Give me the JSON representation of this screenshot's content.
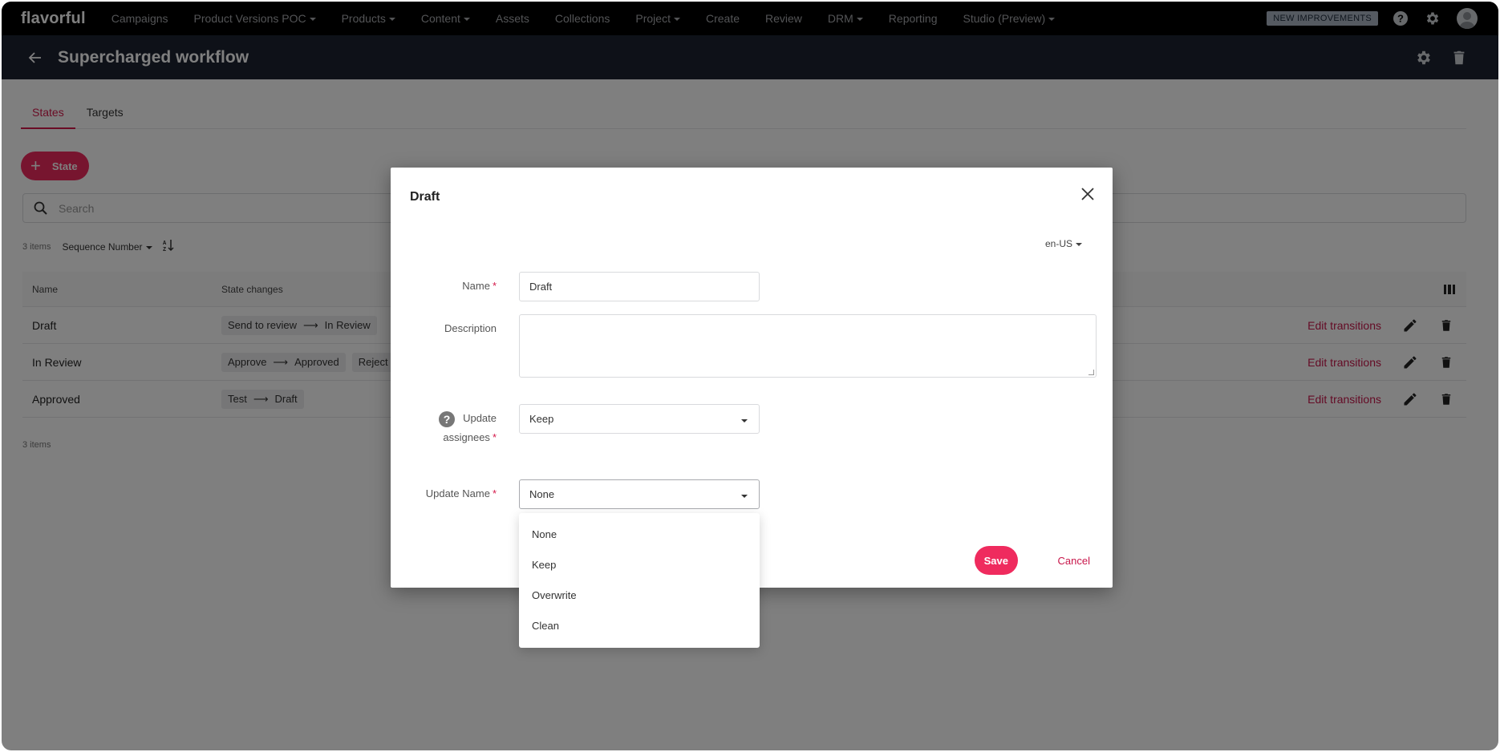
{
  "topnav": {
    "logo": "flavorful",
    "items": [
      {
        "label": "Campaigns",
        "dropdown": false
      },
      {
        "label": "Product Versions POC",
        "dropdown": true
      },
      {
        "label": "Products",
        "dropdown": true
      },
      {
        "label": "Content",
        "dropdown": true
      },
      {
        "label": "Assets",
        "dropdown": false
      },
      {
        "label": "Collections",
        "dropdown": false
      },
      {
        "label": "Project",
        "dropdown": true
      },
      {
        "label": "Create",
        "dropdown": false
      },
      {
        "label": "Review",
        "dropdown": false
      },
      {
        "label": "DRM",
        "dropdown": true
      },
      {
        "label": "Reporting",
        "dropdown": false
      },
      {
        "label": "Studio (Preview)",
        "dropdown": true
      }
    ],
    "badge": "NEW IMPROVEMENTS",
    "icons": [
      "help-icon",
      "settings-icon",
      "user-avatar-icon"
    ]
  },
  "subheader": {
    "title": "Supercharged workflow",
    "icons": [
      "back-arrow-icon",
      "settings-icon",
      "trash-icon"
    ]
  },
  "tabs": [
    {
      "label": "States",
      "active": true
    },
    {
      "label": "Targets",
      "active": false
    }
  ],
  "add_state_label": "State",
  "search": {
    "placeholder": "Search",
    "value": ""
  },
  "list": {
    "count_label": "3 items",
    "sort_by": "Sequence Number",
    "sort_direction": "A-Z ascending",
    "footer_count": "3 items",
    "columns": {
      "name": "Name",
      "state_changes": "State changes"
    },
    "rows": [
      {
        "name": "Draft",
        "changes": [
          {
            "action": "Send to review",
            "target": "In Review"
          }
        ],
        "edit_label": "Edit transitions"
      },
      {
        "name": "In Review",
        "changes": [
          {
            "action": "Approve",
            "target": "Approved"
          },
          {
            "action": "Reject",
            "target": ""
          }
        ],
        "edit_label": "Edit transitions"
      },
      {
        "name": "Approved",
        "changes": [
          {
            "action": "Test",
            "target": "Draft"
          }
        ],
        "edit_label": "Edit transitions"
      }
    ]
  },
  "modal": {
    "title": "Draft",
    "locale": "en-US",
    "fields": {
      "name": {
        "label": "Name",
        "required": true,
        "value": "Draft"
      },
      "description": {
        "label": "Description",
        "required": false,
        "value": ""
      },
      "update_assignees": {
        "label_line1": "Update",
        "label_line2": "assignees",
        "required": true,
        "value": "Keep"
      },
      "update_name": {
        "label": "Update Name",
        "required": true,
        "value": "None"
      }
    },
    "save_label": "Save",
    "cancel_label": "Cancel"
  },
  "dropdown_menu": {
    "options": [
      "None",
      "Keep",
      "Overwrite",
      "Clean"
    ]
  },
  "arrow_glyph": "⟶",
  "colors": {
    "accent": "#ef2b5e",
    "link": "#c8164a",
    "topnav_bg": "#000000",
    "subheader_bg": "#1c2230"
  }
}
